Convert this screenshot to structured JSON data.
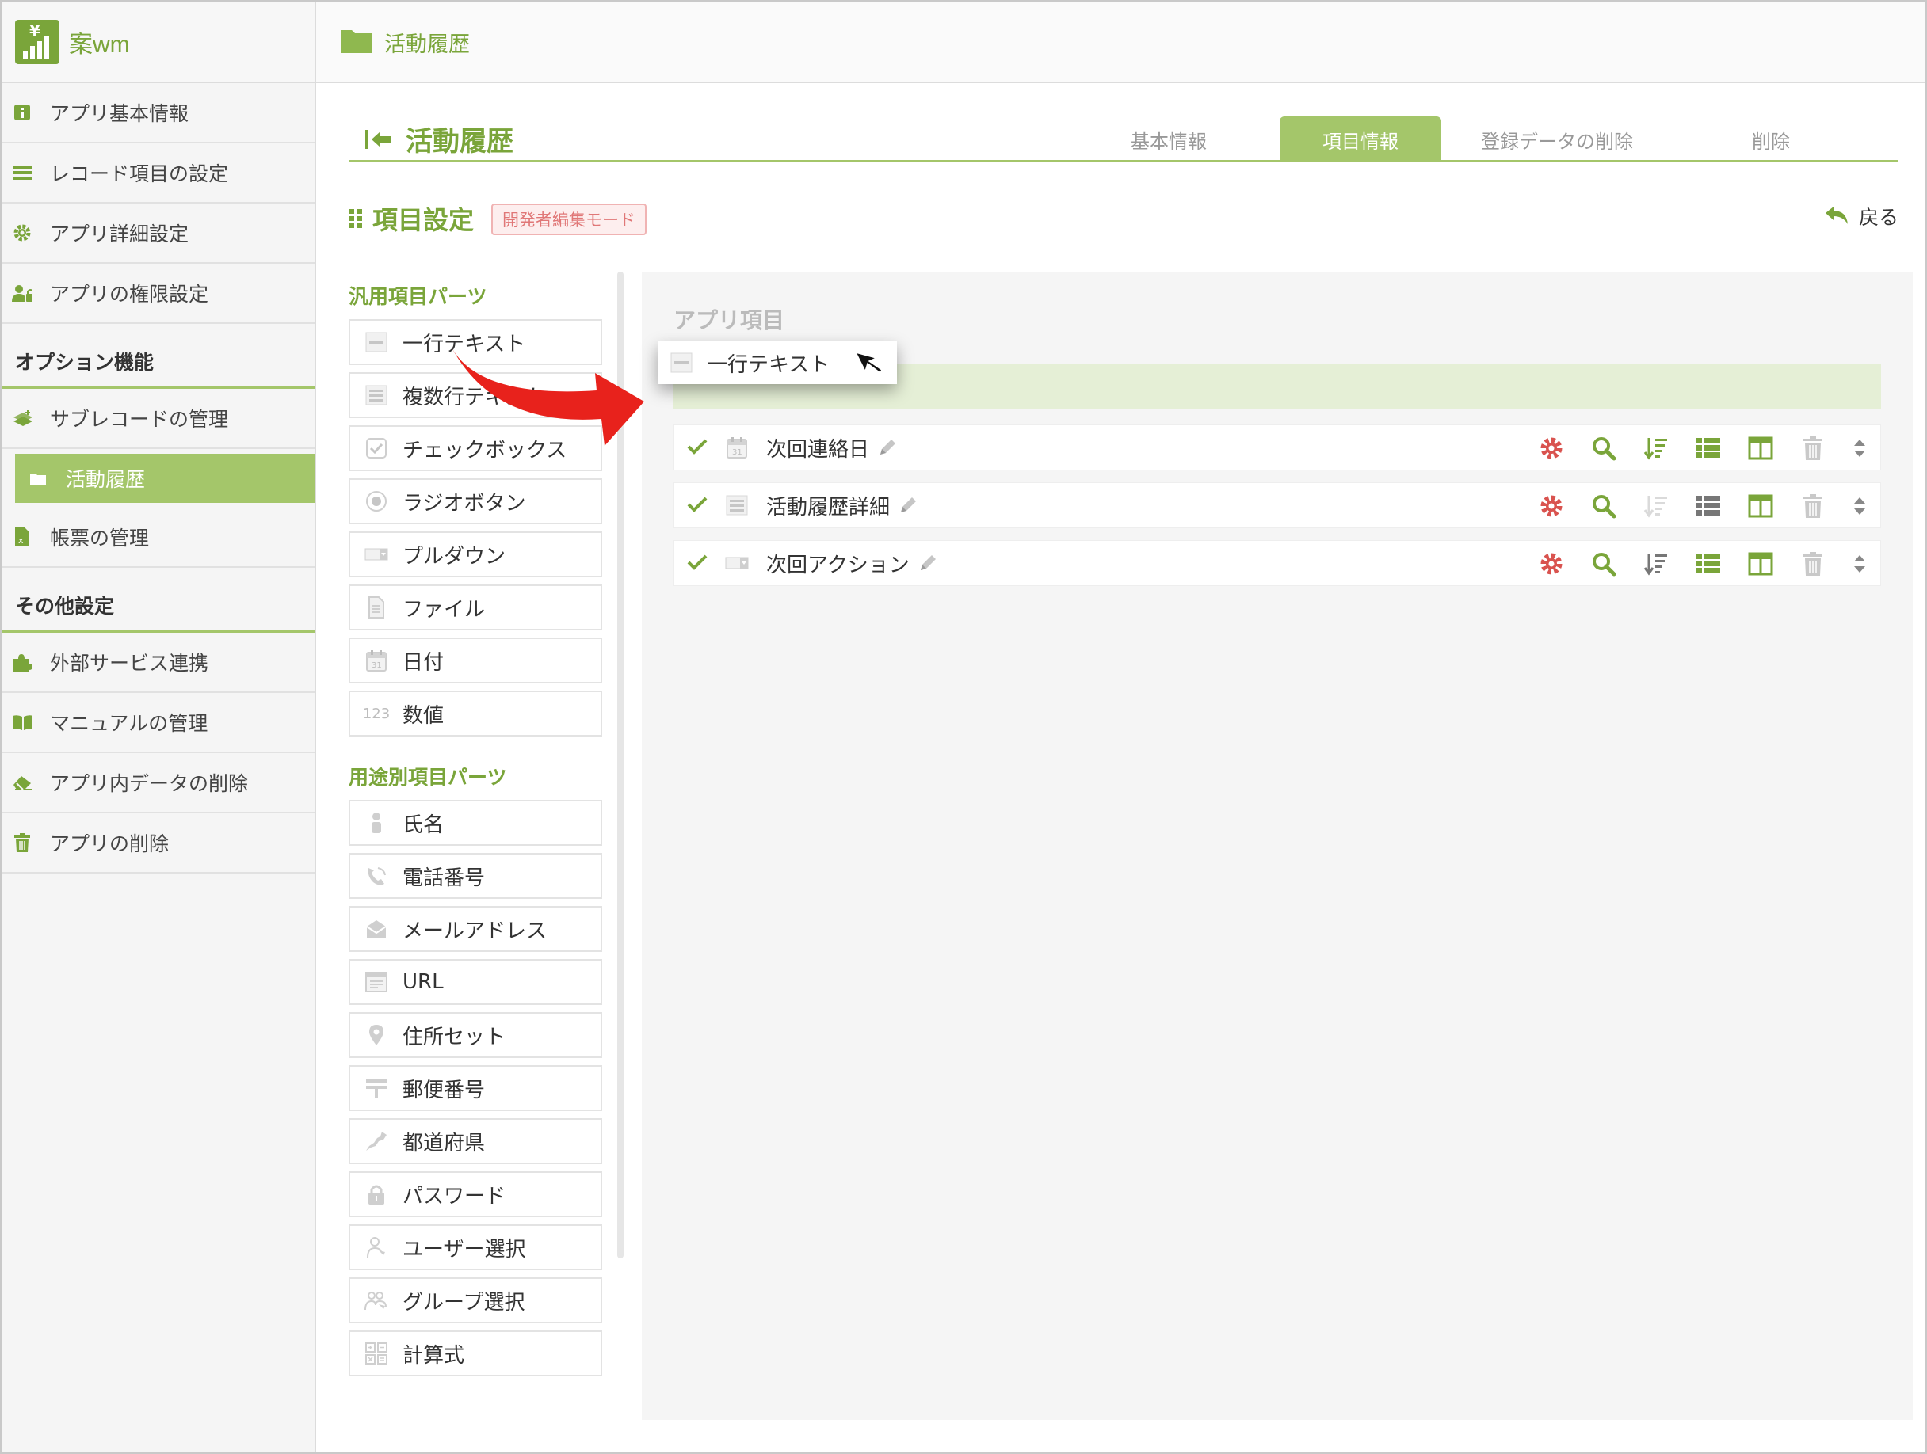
{
  "brand": {
    "name": "案wm"
  },
  "topbar": {
    "title": "活動履歴"
  },
  "sidebar": {
    "items": [
      {
        "label": "アプリ基本情報",
        "icon": "info-icon"
      },
      {
        "label": "レコード項目の設定",
        "icon": "list-icon"
      },
      {
        "label": "アプリ詳細設定",
        "icon": "gear-icon"
      },
      {
        "label": "アプリの権限設定",
        "icon": "user-lock-icon"
      }
    ],
    "option_head": "オプション機能",
    "option_items": [
      {
        "label": "サブレコードの管理",
        "icon": "layers-icon"
      },
      {
        "label": "活動履歴",
        "icon": "folder-icon"
      },
      {
        "label": "帳票の管理",
        "icon": "excel-icon"
      }
    ],
    "other_head": "その他設定",
    "other_items": [
      {
        "label": "外部サービス連携",
        "icon": "puzzle-icon"
      },
      {
        "label": "マニュアルの管理",
        "icon": "book-icon"
      },
      {
        "label": "アプリ内データの削除",
        "icon": "eraser-icon"
      },
      {
        "label": "アプリの削除",
        "icon": "trash-icon"
      }
    ]
  },
  "header": {
    "title": "活動履歴",
    "tabs": [
      "基本情報",
      "項目情報",
      "登録データの削除",
      "削除"
    ],
    "active_tab": "項目情報"
  },
  "settings": {
    "title": "項目設定",
    "badge": "開発者編集モード",
    "back": "戻る"
  },
  "palette": {
    "general_head": "汎用項目パーツ",
    "general": [
      {
        "label": "一行テキスト",
        "icon": "single-line-icon"
      },
      {
        "label": "複数行テキスト",
        "icon": "multi-line-icon"
      },
      {
        "label": "チェックボックス",
        "icon": "checkbox-icon"
      },
      {
        "label": "ラジオボタン",
        "icon": "radio-icon"
      },
      {
        "label": "プルダウン",
        "icon": "dropdown-icon"
      },
      {
        "label": "ファイル",
        "icon": "file-icon"
      },
      {
        "label": "日付",
        "icon": "calendar-icon"
      },
      {
        "label": "数値",
        "icon": "number-icon",
        "glyph": "123"
      }
    ],
    "purpose_head": "用途別項目パーツ",
    "purpose": [
      {
        "label": "氏名",
        "icon": "person-icon"
      },
      {
        "label": "電話番号",
        "icon": "phone-icon"
      },
      {
        "label": "メールアドレス",
        "icon": "mail-icon"
      },
      {
        "label": "URL",
        "icon": "browser-icon"
      },
      {
        "label": "住所セット",
        "icon": "map-pin-icon"
      },
      {
        "label": "郵便番号",
        "icon": "postal-icon"
      },
      {
        "label": "都道府県",
        "icon": "japan-map-icon"
      },
      {
        "label": "パスワード",
        "icon": "lock-icon"
      },
      {
        "label": "ユーザー選択",
        "icon": "user-select-icon"
      },
      {
        "label": "グループ選択",
        "icon": "group-select-icon"
      },
      {
        "label": "計算式",
        "icon": "calculator-icon"
      }
    ]
  },
  "canvas": {
    "title": "アプリ項目",
    "drag_item": "一行テキスト",
    "fields": [
      {
        "name": "次回連絡日",
        "type_icon": "calendar-icon",
        "sort_enabled": true
      },
      {
        "name": "活動履歴詳細",
        "type_icon": "multi-line-icon",
        "sort_enabled": false
      },
      {
        "name": "次回アクション",
        "type_icon": "dropdown-icon",
        "sort_enabled": true
      }
    ]
  },
  "colors": {
    "accent": "#a4c66a",
    "accent_dark": "#7aa53a",
    "danger": "#d9534f",
    "arrow": "#e8221c"
  }
}
